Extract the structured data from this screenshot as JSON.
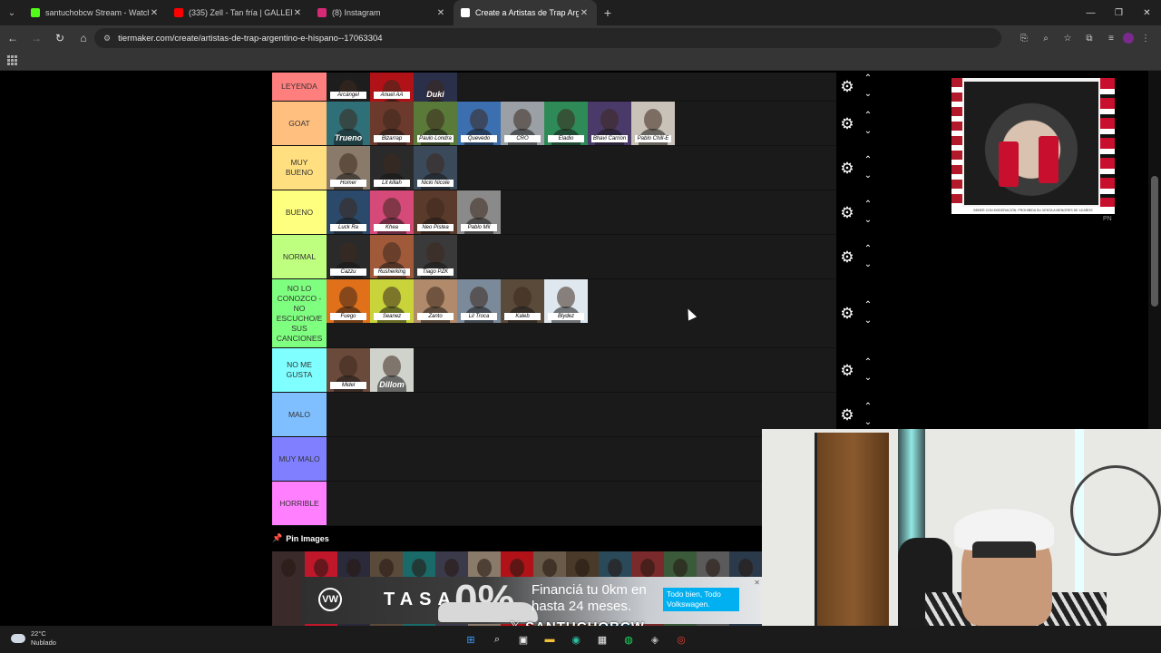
{
  "browser": {
    "tabs": [
      {
        "title": "santuchobcw Stream - Watch L",
        "favicon_color": "#53fc18",
        "active": false
      },
      {
        "title": "(335) Zell - Tan fría | GALLERY S",
        "favicon_color": "#ff0000",
        "active": false
      },
      {
        "title": "(8) Instagram",
        "favicon_color": "#d62976",
        "active": false
      },
      {
        "title": "Create a Artistas de Trap Argen",
        "favicon_color": "#ffffff",
        "active": true
      }
    ],
    "url": "tiermaker.com/create/artistas-de-trap-argentino-e-hispano--17063304"
  },
  "tiers": [
    {
      "label": "LEYENDA",
      "color": "#ff7f7f",
      "height": 32,
      "items": [
        {
          "caption": "Arcángel",
          "bg": "#1d1d1d"
        },
        {
          "caption": "Anuel AA",
          "bg": "#b01218"
        },
        {
          "caption": "Duki",
          "bg": "#2a2f4a"
        }
      ]
    },
    {
      "label": "GOAT",
      "color": "#ffbf7f",
      "height": 49,
      "items": [
        {
          "caption": "Trueno",
          "bg": "#2f6f78"
        },
        {
          "caption": "Bizarrap",
          "bg": "#6b3a2c"
        },
        {
          "caption": "Paulo Londra",
          "bg": "#5a7a3a"
        },
        {
          "caption": "Quevedo",
          "bg": "#3b6fb0"
        },
        {
          "caption": "CRO",
          "bg": "#9aa0a6"
        },
        {
          "caption": "Eladio",
          "bg": "#2e8b57"
        },
        {
          "caption": "Bhavi Carrion",
          "bg": "#4a3a6a"
        },
        {
          "caption": "Pablo Chill-E",
          "bg": "#c9c2b8"
        }
      ]
    },
    {
      "label": "MUY\nBUENO",
      "color": "#ffdf7f",
      "height": 49,
      "items": [
        {
          "caption": "Homer",
          "bg": "#8a7a6a"
        },
        {
          "caption": "Lit killah",
          "bg": "#2a2a2a"
        },
        {
          "caption": "Nicki Nicole",
          "bg": "#3a4a5a"
        }
      ]
    },
    {
      "label": "BUENO",
      "color": "#ffff7f",
      "height": 49,
      "items": [
        {
          "caption": "Luck Ra",
          "bg": "#2b4a6b"
        },
        {
          "caption": "Khea",
          "bg": "#d64a7a"
        },
        {
          "caption": "Neo Pistea",
          "bg": "#5a3a2a"
        },
        {
          "caption": "Pablo Mil",
          "bg": "#8a8a8a"
        }
      ]
    },
    {
      "label": "NORMAL",
      "color": "#bfff7f",
      "height": 49,
      "items": [
        {
          "caption": "Cazzu",
          "bg": "#2a2a2a"
        },
        {
          "caption": "Rusherking",
          "bg": "#a05a3a"
        },
        {
          "caption": "Tiago PZK",
          "bg": "#3a3a3a"
        }
      ]
    },
    {
      "label": "NO LO\nCONOZCO -\nNO\nESCUCHO/E\nSUS\nCANCIONES",
      "color": "#7fff7f",
      "height": 76,
      "items": [
        {
          "caption": "Fuego",
          "bg": "#e0701a"
        },
        {
          "caption": "Seanez",
          "bg": "#c8d43a"
        },
        {
          "caption": "Zanto",
          "bg": "#b08a6a"
        },
        {
          "caption": "Lil Troca",
          "bg": "#7a8a9a"
        },
        {
          "caption": "Kaleb",
          "bg": "#5a4a3a"
        },
        {
          "caption": "Blydez",
          "bg": "#dfe8ef"
        }
      ]
    },
    {
      "label": "NO ME\nGUSTA",
      "color": "#7fffff",
      "height": 49,
      "items": [
        {
          "caption": "Midel",
          "bg": "#6a4a3a"
        },
        {
          "caption": "Dillom",
          "bg": "#d0d2cc"
        }
      ]
    },
    {
      "label": "MALO",
      "color": "#7fbfff",
      "height": 49,
      "items": []
    },
    {
      "label": "MUY MALO",
      "color": "#7f7fff",
      "height": 49,
      "items": []
    },
    {
      "label": "HORRIBLE",
      "color": "#ff7fff",
      "height": 49,
      "items": []
    }
  ],
  "pin_images": {
    "title": "Pin Images",
    "tiles": [
      "#3a2a2a",
      "#c0182a",
      "#2a2a3a",
      "#5a4a3a",
      "#1a6a6a",
      "#3a3a4a",
      "#8a7a6a",
      "#b01218",
      "#6a5a4a",
      "#4a3a2a",
      "#2a4a5a",
      "#7a2a2a",
      "#3a5a3a",
      "#5a5a5a",
      "#2a3a4a"
    ]
  },
  "ad_banner": {
    "brand_letter": "VW",
    "tasa": "TASA",
    "percent": "0%",
    "copy_line1": "Financiá tu 0km en",
    "copy_line2": "hasta 24 meses.",
    "cta": "Todo bien, Todo Volkswagen."
  },
  "side_ad": {
    "disclaimer": "BEBER CON MODERACIÓN. PROHIBIDA SU VENTA A MENORES DE 18 AÑOS",
    "corner": "PN"
  },
  "overlay": {
    "x_glyph": "𝕏",
    "name": "SANTUCHOBCW"
  },
  "taskbar": {
    "temp": "22°C",
    "condition": "Nublado"
  }
}
